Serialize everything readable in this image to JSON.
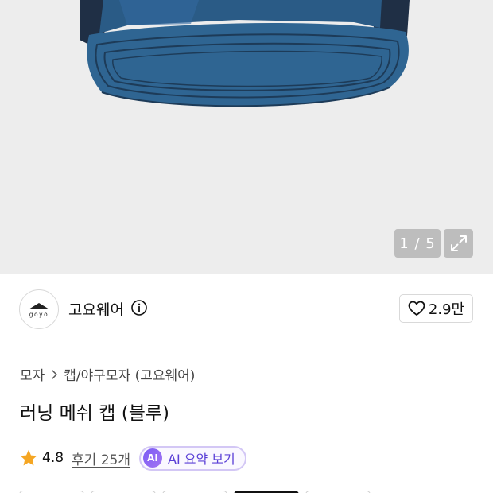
{
  "gallery": {
    "counter": "1 / 5",
    "image_icon": "cap-product-image",
    "expand_icon": "expand-icon"
  },
  "brand": {
    "logo_text": "goyo",
    "name": "고요웨어",
    "info_icon": "info-icon"
  },
  "like": {
    "icon": "heart-icon",
    "count": "2.9만"
  },
  "breadcrumb": {
    "items": [
      "모자",
      "캡/야구모자 (고요웨어)"
    ]
  },
  "product": {
    "title": "러닝 메쉬 캡 (블루)"
  },
  "rating": {
    "value": "4.8",
    "reviews": "후기 25개",
    "ai_badge": "AI",
    "ai_label": "AI 요약 보기"
  },
  "colors": {
    "cap_blue": "#2c5d86",
    "accent_purple": "#7b5cf5",
    "star": "#f5a623"
  }
}
